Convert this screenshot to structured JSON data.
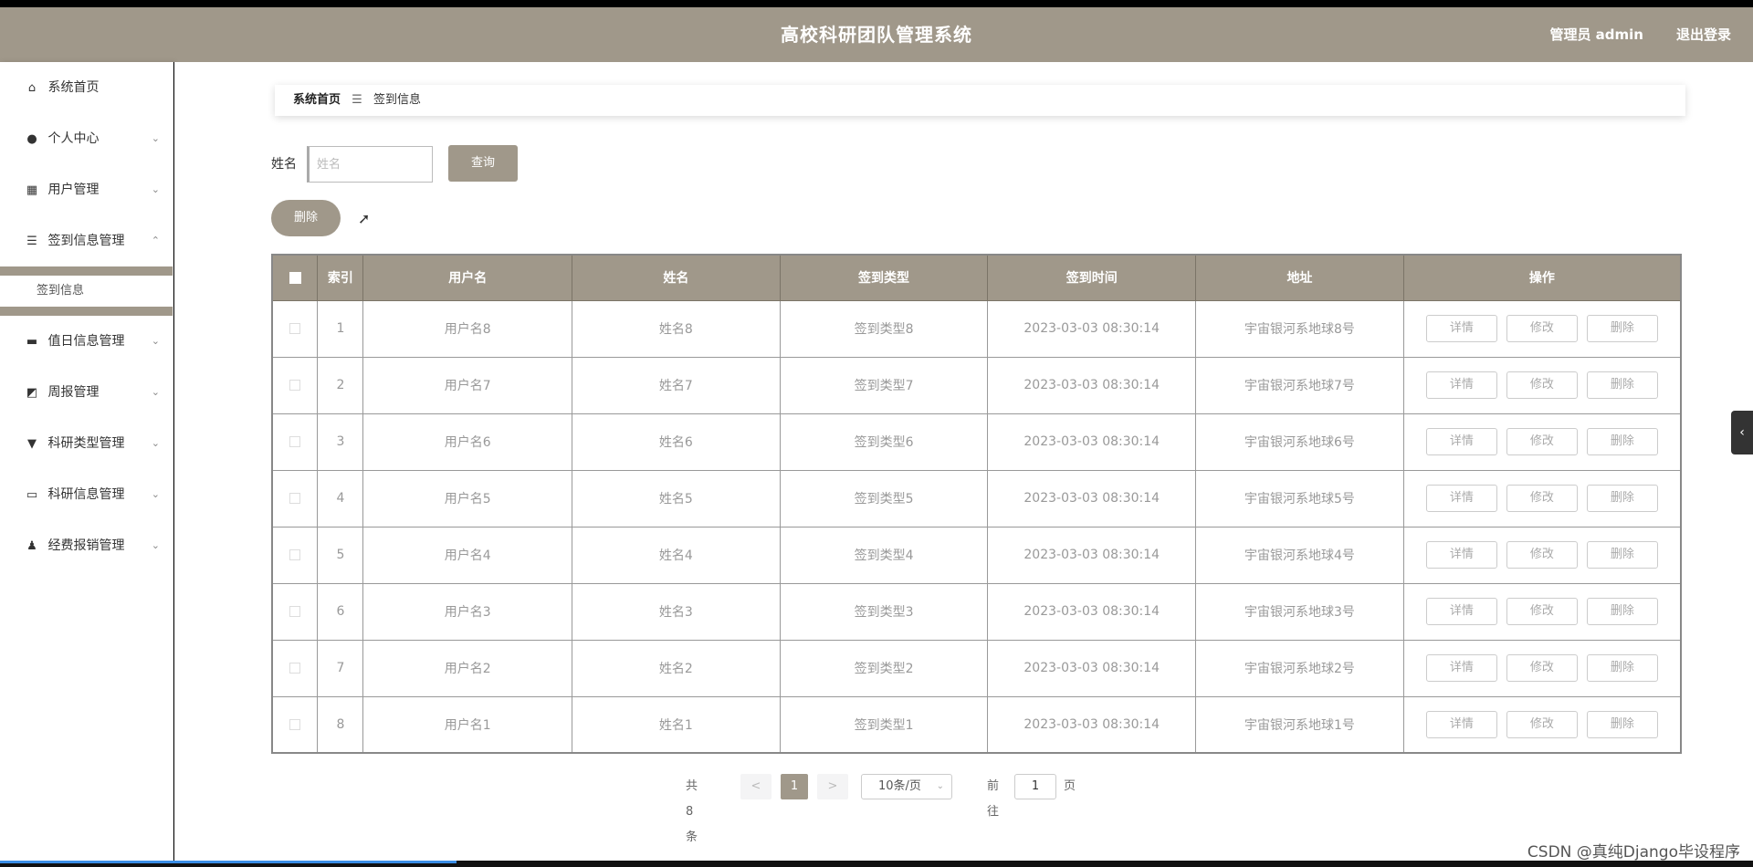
{
  "header": {
    "title": "高校科研团队管理系统",
    "user": "管理员 admin",
    "logout": "退出登录"
  },
  "sidebar": {
    "items": [
      {
        "label": "系统首页",
        "icon": "home-icon",
        "glyph": "⌂"
      },
      {
        "label": "个人中心",
        "icon": "user-icon",
        "glyph": "●"
      },
      {
        "label": "用户管理",
        "icon": "grid-icon",
        "glyph": "▦"
      },
      {
        "label": "签到信息管理",
        "icon": "list-icon",
        "glyph": "☰"
      },
      {
        "label": "值日信息管理",
        "icon": "ticket-icon",
        "glyph": "▬"
      },
      {
        "label": "周报管理",
        "icon": "chart-icon",
        "glyph": "◩"
      },
      {
        "label": "科研类型管理",
        "icon": "flag-icon",
        "glyph": "▼"
      },
      {
        "label": "科研信息管理",
        "icon": "monitor-icon",
        "glyph": "▭"
      },
      {
        "label": "经费报销管理",
        "icon": "person-icon",
        "glyph": "♟"
      }
    ],
    "sub_items": {
      "signin": [
        {
          "label": "签到信息"
        }
      ]
    },
    "chevron_down": "⌄",
    "chevron_up": "⌃"
  },
  "breadcrumb": {
    "home": "系统首页",
    "separator": "☰",
    "current": "签到信息"
  },
  "search": {
    "label": "姓名",
    "placeholder": "姓名",
    "value": "",
    "query_button": "查询"
  },
  "actions": {
    "batch_delete": "删除"
  },
  "table": {
    "columns": [
      "",
      "索引",
      "用户名",
      "姓名",
      "签到类型",
      "签到时间",
      "地址",
      "操作"
    ],
    "rows": [
      {
        "index": "1",
        "username": "用户名8",
        "name": "姓名8",
        "type": "签到类型8",
        "time": "2023-03-03 08:30:14",
        "address": "宇宙银河系地球8号"
      },
      {
        "index": "2",
        "username": "用户名7",
        "name": "姓名7",
        "type": "签到类型7",
        "time": "2023-03-03 08:30:14",
        "address": "宇宙银河系地球7号"
      },
      {
        "index": "3",
        "username": "用户名6",
        "name": "姓名6",
        "type": "签到类型6",
        "time": "2023-03-03 08:30:14",
        "address": "宇宙银河系地球6号"
      },
      {
        "index": "4",
        "username": "用户名5",
        "name": "姓名5",
        "type": "签到类型5",
        "time": "2023-03-03 08:30:14",
        "address": "宇宙银河系地球5号"
      },
      {
        "index": "5",
        "username": "用户名4",
        "name": "姓名4",
        "type": "签到类型4",
        "time": "2023-03-03 08:30:14",
        "address": "宇宙银河系地球4号"
      },
      {
        "index": "6",
        "username": "用户名3",
        "name": "姓名3",
        "type": "签到类型3",
        "time": "2023-03-03 08:30:14",
        "address": "宇宙银河系地球3号"
      },
      {
        "index": "7",
        "username": "用户名2",
        "name": "姓名2",
        "type": "签到类型2",
        "time": "2023-03-03 08:30:14",
        "address": "宇宙银河系地球2号"
      },
      {
        "index": "8",
        "username": "用户名1",
        "name": "姓名1",
        "type": "签到类型1",
        "time": "2023-03-03 08:30:14",
        "address": "宇宙银河系地球1号"
      }
    ],
    "row_actions": {
      "detail": "详情",
      "edit": "修改",
      "delete": "删除"
    }
  },
  "pagination": {
    "total": "共 8 条",
    "prev": "<",
    "current_page": "1",
    "next": ">",
    "page_size": "10条/页",
    "goto_label": "前往",
    "goto_value": "1",
    "page_unit": "页"
  },
  "side_toggle": "‹",
  "watermark": "CSDN @真纯Django毕设程序",
  "colors": {
    "accent": "#a0988a",
    "header_text": "#ffffff"
  }
}
